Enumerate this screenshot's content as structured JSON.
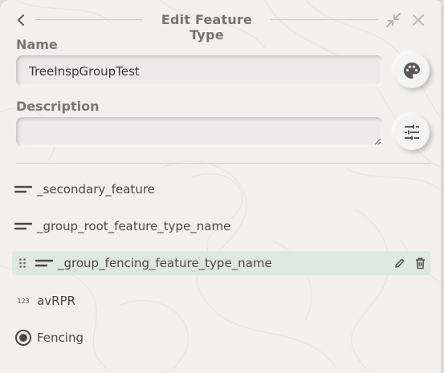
{
  "header": {
    "title": "Edit Feature Type",
    "back_icon": "chevron-left-icon",
    "collapse_icon": "collapse-arrows-icon",
    "close_icon": "close-icon"
  },
  "form": {
    "name_label": "Name",
    "name_value": "TreeInspGroupTest",
    "description_label": "Description",
    "description_value": "",
    "palette_icon": "palette-icon",
    "tune_icon": "tune-icon"
  },
  "items": [
    {
      "label": "_secondary_feature",
      "icon": "text-field-icon"
    },
    {
      "label": "_group_root_feature_type_name",
      "icon": "text-field-icon"
    },
    {
      "label": "_group_fencing_feature_type_name",
      "icon": "text-field-icon",
      "selected": true
    },
    {
      "label": "avRPR",
      "icon": "number-field-icon",
      "icon_text": "123"
    },
    {
      "label": "Fencing",
      "icon": "radio-icon"
    }
  ],
  "colors": {
    "background": "#f1f0ef",
    "selected_row": "#dde8e3",
    "title": "#777173",
    "text": "#4b4748"
  }
}
